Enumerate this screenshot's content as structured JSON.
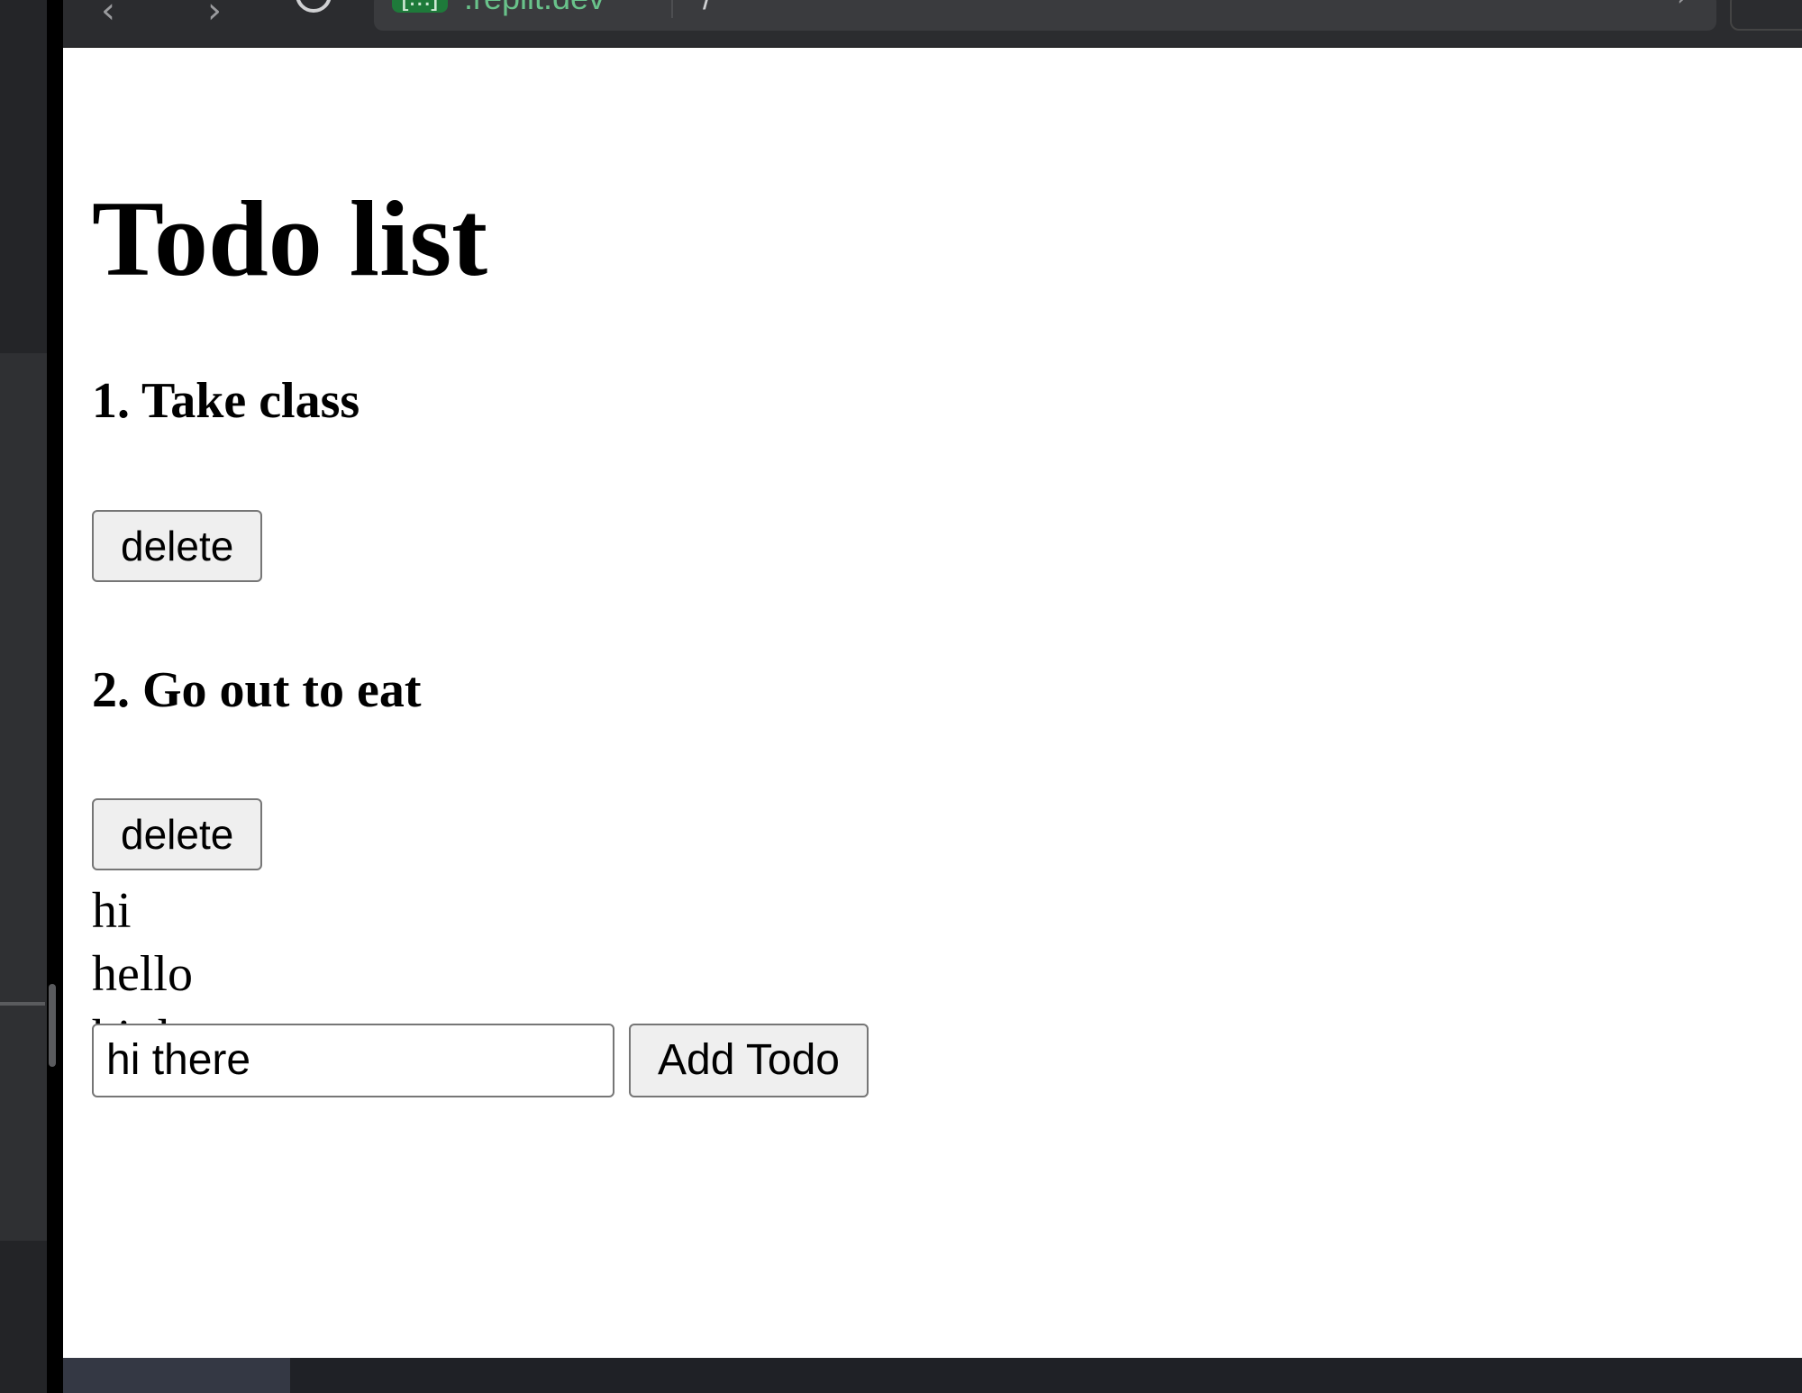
{
  "browser": {
    "url_badge": "[...]",
    "url_host": ".replit.dev",
    "url_path": "/"
  },
  "page": {
    "title": "Todo list",
    "todos": [
      {
        "title": "1. Take class",
        "delete_label": "delete"
      },
      {
        "title": "2. Go out to eat",
        "delete_label": "delete"
      }
    ],
    "extra_lines": [
      "hi",
      "hello",
      "hi there"
    ],
    "input_value": "hi there",
    "add_button_label": "Add Todo"
  }
}
